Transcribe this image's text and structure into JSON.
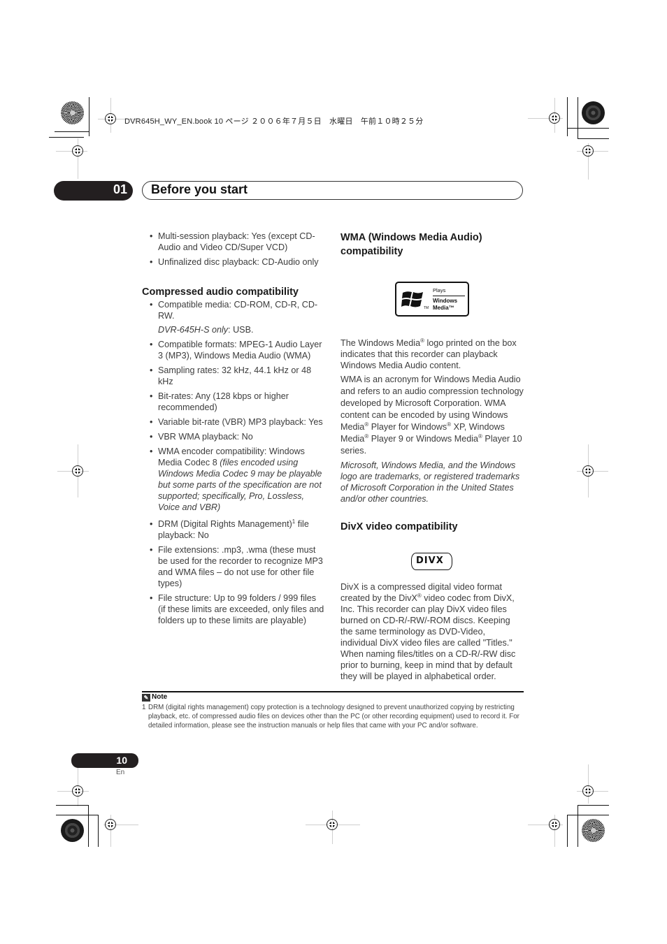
{
  "print_header": {
    "text": "DVR645H_WY_EN.book  10 ページ  ２００６年７月５日　水曜日　午前１０時２５分"
  },
  "chapter": {
    "number": "01",
    "title": "Before you start"
  },
  "left_column": {
    "intro_bullets": [
      "Multi-session playback: Yes (except CD-Audio and Video CD/Super VCD)",
      "Unfinalized disc playback: CD-Audio only"
    ],
    "compressed_audio": {
      "heading": "Compressed audio compatibility",
      "media_bullet": "Compatible media: CD-ROM, CD-R, CD-RW.",
      "media_note_italic": "DVR-645H-S only",
      "media_note_rest": ": USB.",
      "bullets": [
        "Compatible formats: MPEG-1 Audio Layer 3 (MP3), Windows Media Audio (WMA)",
        "Sampling rates: 32 kHz, 44.1 kHz or 48 kHz",
        "Bit-rates: Any (128 kbps or higher recommended)",
        "Variable bit-rate (VBR) MP3 playback: Yes",
        "VBR WMA playback: No"
      ],
      "encoder_bullet_plain": "WMA encoder compatibility: Windows Media Codec 8 ",
      "encoder_bullet_italic": "(files encoded using Windows Media Codec 9 may be playable but some parts of the specification are not supported; specifically, Pro, Lossless, Voice and VBR)",
      "drm_bullet_before": "DRM (Digital Rights Management)",
      "drm_bullet_footnote": "1",
      "drm_bullet_after": " file playback: No",
      "more_bullets": [
        "File extensions: .mp3, .wma (these must be used for the recorder to recognize MP3 and WMA files – do not use for other file types)",
        "File structure: Up to 99 folders / 999 files (if these limits are exceeded, only files and folders up to these limits are playable)"
      ]
    }
  },
  "right_column": {
    "wma": {
      "heading": "WMA (Windows Media Audio) compatibility",
      "logo": {
        "icon": "windows-flag-icon",
        "tm": "TM",
        "plays": "Plays",
        "line1": "Windows",
        "line2": "Media™"
      },
      "p1_a": "The Windows Media",
      "reg": "®",
      "p1_b": " logo printed on the box indicates that this recorder can playback Windows Media Audio content.",
      "p2_a": "WMA is an acronym for Windows Media Audio and refers to an audio compression technology developed by Microsoft Corporation. WMA content can be encoded by using Windows Media",
      "p2_b": " Player for Windows",
      "p2_c": " XP, Windows Media",
      "p2_d": " Player 9 or Windows Media",
      "p2_e": " Player 10 series.",
      "trademark_italic": "Microsoft, Windows Media, and the Windows logo are trademarks, or registered trademarks of Microsoft Corporation in the United States and/or other countries."
    },
    "divx": {
      "heading": "DivX video compatibility",
      "logo_text": "DIVX",
      "p_a": "DivX is a compressed digital video format created by the DivX",
      "p_b": " video codec from DivX, Inc. This recorder can play DivX video files burned on CD-R/-RW/-ROM discs. Keeping the same terminology as DVD-Video, individual DivX video files are called \"Titles.\" When naming files/titles on a CD-R/-RW disc prior to burning, keep in mind that by default they will be played in alphabetical order."
    }
  },
  "note": {
    "icon": "pencil-note-icon",
    "label": "Note",
    "items": [
      {
        "number": "1",
        "text": "DRM (digital rights management) copy protection is a technology designed to prevent unauthorized copying by restricting playback, etc. of compressed audio files on devices other than the PC (or other recording equipment) used to record it. For detailed information, please see the instruction manuals or help files that came with your PC and/or software."
      }
    ]
  },
  "footer": {
    "page_number": "10",
    "language": "En"
  }
}
